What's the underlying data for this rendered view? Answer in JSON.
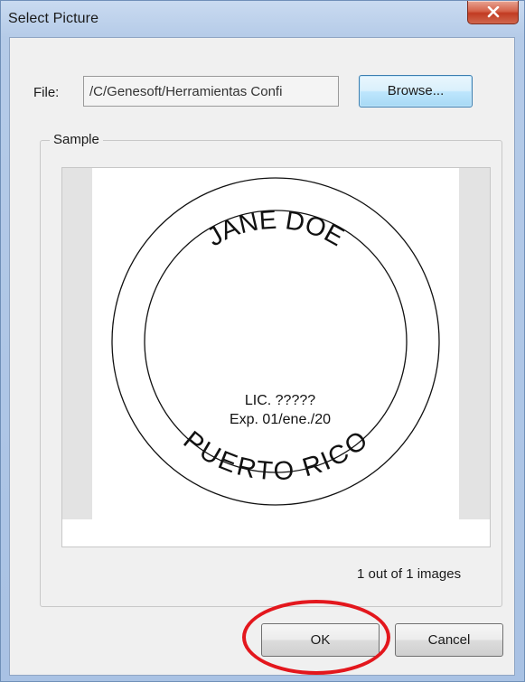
{
  "window": {
    "title": "Select Picture",
    "close_label": "x"
  },
  "file": {
    "label": "File:",
    "value": "/C/Genesoft/Herramientas Confi",
    "browse_label": "Browse..."
  },
  "sample": {
    "group_label": "Sample",
    "seal_top_text": "JANE DOE",
    "seal_bottom_text": "PUERTO RICO",
    "license_line": "LIC. ?????",
    "expiry_line": "Exp. 01/ene./20"
  },
  "counter_text": "1 out of 1 images",
  "buttons": {
    "ok_label": "OK",
    "cancel_label": "Cancel"
  },
  "colors": {
    "highlight": "#e3171d",
    "close_button": "#c23b22",
    "dialog_background": "#f0f0f0"
  }
}
